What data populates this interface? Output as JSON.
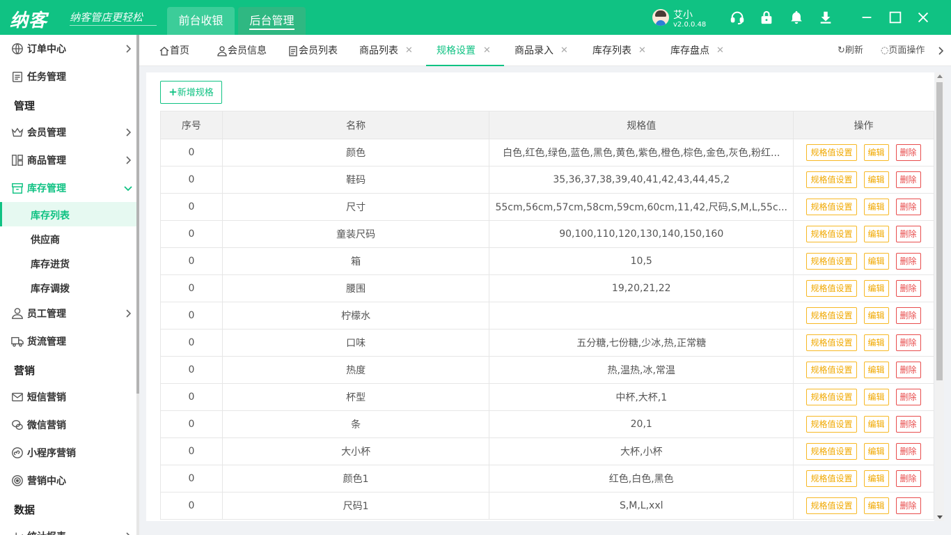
{
  "app": {
    "logo": "纳客",
    "slogan": "纳客管店更轻松",
    "user_name": "艾小",
    "version": "v2.0.0.48",
    "brand_color": "#10c283"
  },
  "topnav": [
    {
      "label": "前台收银"
    },
    {
      "label": "后台管理"
    }
  ],
  "window_icons": [
    "headset-icon",
    "lock-icon",
    "bell-icon",
    "download-icon",
    "minimize-icon",
    "maximize-icon",
    "close-icon"
  ],
  "sidebar": {
    "items": [
      {
        "label": "订单中心",
        "icon": "globe-icon"
      },
      {
        "label": "任务管理",
        "icon": "clipboard-icon"
      },
      {
        "group": "管理"
      },
      {
        "label": "会员管理",
        "icon": "crown-icon"
      },
      {
        "label": "商品管理",
        "icon": "grid-icon"
      },
      {
        "label": "库存管理",
        "icon": "box-icon"
      },
      {
        "label": "员工管理",
        "icon": "user-icon"
      },
      {
        "label": "货流管理",
        "icon": "truck-icon"
      },
      {
        "group": "营销"
      },
      {
        "label": "短信营销",
        "icon": "mail-icon"
      },
      {
        "label": "微信营销",
        "icon": "wechat-icon"
      },
      {
        "label": "小程序营销",
        "icon": "miniprogram-icon"
      },
      {
        "label": "营销中心",
        "icon": "target-icon"
      },
      {
        "group": "数据"
      },
      {
        "label": "统计报表",
        "icon": "chart-icon"
      }
    ],
    "subitems": [
      {
        "label": "库存列表"
      },
      {
        "label": "供应商"
      },
      {
        "label": "库存进货"
      },
      {
        "label": "库存调拨"
      }
    ]
  },
  "tabs": [
    {
      "label": "首页"
    },
    {
      "label": "会员信息"
    },
    {
      "label": "会员列表"
    },
    {
      "label": "商品列表"
    },
    {
      "label": "规格设置"
    },
    {
      "label": "商品录入"
    },
    {
      "label": "库存列表"
    },
    {
      "label": "库存盘点"
    }
  ],
  "tab_tools": {
    "refresh": "刷新",
    "page_ops": "页面操作"
  },
  "toolbar": {
    "add_label": "新增规格"
  },
  "table": {
    "headers": [
      "序号",
      "名称",
      "规格值",
      "操作"
    ],
    "op_labels": {
      "set": "规格值设置",
      "edit": "编辑",
      "delete": "删除"
    },
    "rows": [
      {
        "no": "0",
        "name": "颜色",
        "values": "白色,红色,绿色,蓝色,黑色,黄色,紫色,橙色,棕色,金色,灰色,粉红..."
      },
      {
        "no": "0",
        "name": "鞋码",
        "values": "35,36,37,38,39,40,41,42,43,44,45,2"
      },
      {
        "no": "0",
        "name": "尺寸",
        "values": "55cm,56cm,57cm,58cm,59cm,60cm,11,42,尺码,S,M,L,55c..."
      },
      {
        "no": "0",
        "name": "童装尺码",
        "values": "90,100,110,120,130,140,150,160"
      },
      {
        "no": "0",
        "name": "箱",
        "values": "10,5"
      },
      {
        "no": "0",
        "name": "腰围",
        "values": "19,20,21,22"
      },
      {
        "no": "0",
        "name": "柠檬水",
        "values": ""
      },
      {
        "no": "0",
        "name": "口味",
        "values": "五分糖,七份糖,少冰,热,正常糖"
      },
      {
        "no": "0",
        "name": "热度",
        "values": "热,温热,冰,常温"
      },
      {
        "no": "0",
        "name": "杯型",
        "values": "中杯,大杯,1"
      },
      {
        "no": "0",
        "name": "条",
        "values": "20,1"
      },
      {
        "no": "0",
        "name": "大小杯",
        "values": "大杯,小杯"
      },
      {
        "no": "0",
        "name": "颜色1",
        "values": "红色,白色,黑色"
      },
      {
        "no": "0",
        "name": "尺码1",
        "values": "S,M,L,xxl"
      }
    ]
  }
}
